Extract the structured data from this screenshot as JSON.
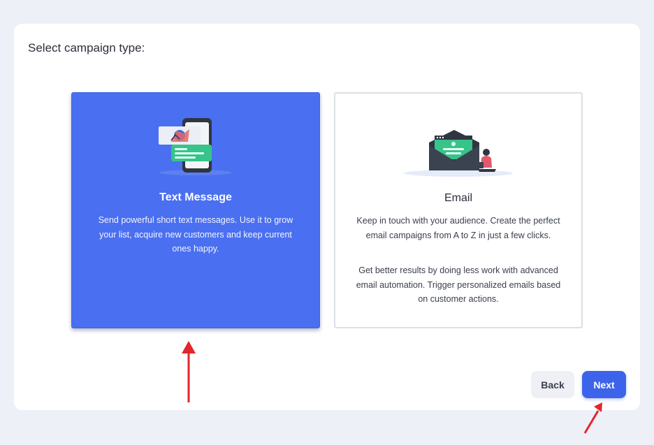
{
  "page": {
    "title": "Select campaign type:"
  },
  "cards": [
    {
      "id": "text-message",
      "title": "Text Message",
      "description": "Send powerful short text messages. Use it to grow your list, acquire new customers and keep current ones happy.",
      "selected": true,
      "icon": "phone-chat-illustration"
    },
    {
      "id": "email",
      "title": "Email",
      "description": "Keep in touch with your audience. Create the perfect email campaigns from A to Z in just a few clicks.",
      "description2": "Get better results by doing less work with advanced email automation. Trigger personalized emails based on customer actions.",
      "selected": false,
      "icon": "envelope-person-illustration"
    }
  ],
  "actions": {
    "back_label": "Back",
    "next_label": "Next"
  },
  "annotations": {
    "arrow_color": "#e3262b"
  },
  "colors": {
    "accent": "#4a6ff0",
    "primary_button": "#3d63eb",
    "background": "#eef0f8"
  }
}
